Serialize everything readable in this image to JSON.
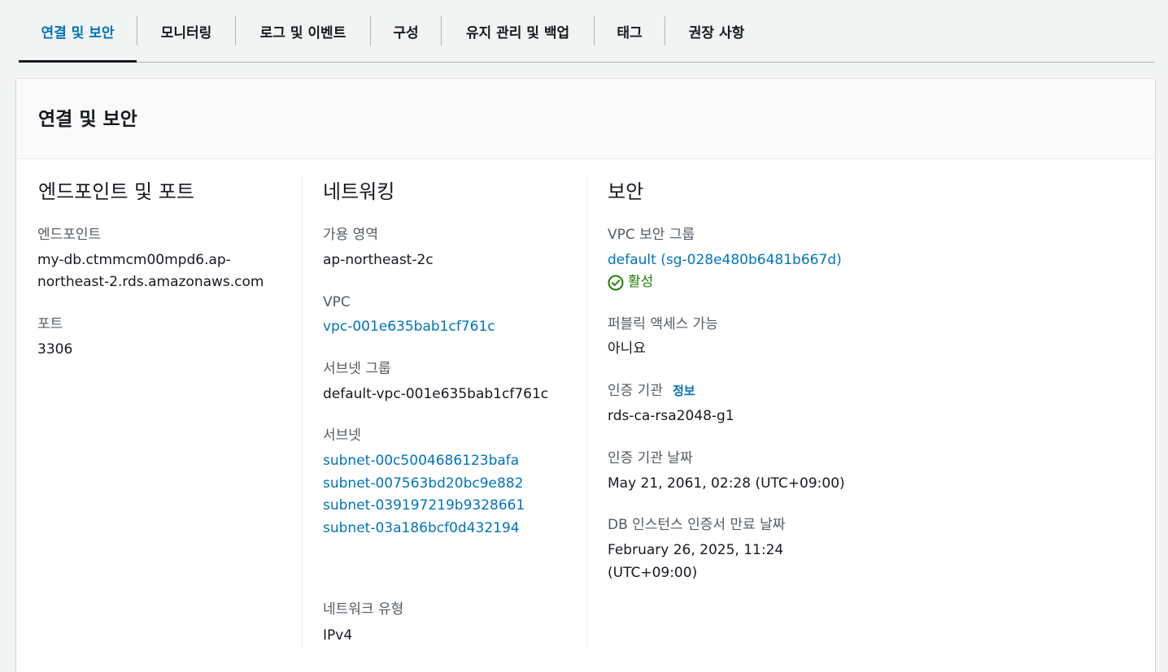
{
  "tabs": [
    {
      "label": "연결 및 보안",
      "active": true
    },
    {
      "label": "모니터링"
    },
    {
      "label": "로그 및 이벤트"
    },
    {
      "label": "구성"
    },
    {
      "label": "유지 관리 및 백업"
    },
    {
      "label": "태그"
    },
    {
      "label": "권장 사항"
    }
  ],
  "panel": {
    "title": "연결 및 보안",
    "endpoint_section": {
      "heading": "엔드포인트 및 포트",
      "endpoint_label": "엔드포인트",
      "endpoint_line1": "my-db.ctmmcm00mpd6.ap-",
      "endpoint_line2": "northeast-2.rds.amazonaws.com",
      "port_label": "포트",
      "port_value": "3306"
    },
    "network_section": {
      "heading": "네트워킹",
      "az_label": "가용 영역",
      "az_value": "ap-northeast-2c",
      "vpc_label": "VPC",
      "vpc_value": "vpc-001e635bab1cf761c",
      "subnet_group_label": "서브넷 그룹",
      "subnet_group_value": "default-vpc-001e635bab1cf761c",
      "subnets_label": "서브넷",
      "subnets": [
        "subnet-00c5004686123bafa",
        "subnet-007563bd20bc9e882",
        "subnet-039197219b9328661",
        "subnet-03a186bcf0d432194"
      ],
      "network_type_label": "네트워크 유형",
      "network_type_value": "IPv4"
    },
    "security_section": {
      "heading": "보안",
      "sg_label": "VPC 보안 그룹",
      "sg_value": "default (sg-028e480b6481b667d)",
      "sg_status": "활성",
      "public_label": "퍼블릭 액세스 가능",
      "public_value": "아니요",
      "ca_label": "인증 기관",
      "ca_info": "정보",
      "ca_value": "rds-ca-rsa2048-g1",
      "ca_date_label": "인증 기관 날짜",
      "ca_date_value": "May 21, 2061, 02:28 (UTC+09:00)",
      "cert_expiry_label": "DB 인스턴스 인증서 만료 날짜",
      "cert_expiry_line1": "February 26, 2025, 11:24",
      "cert_expiry_line2": "(UTC+09:00)"
    }
  },
  "colors": {
    "accent": "#0073bb",
    "success": "#1d8102",
    "label": "#545b64"
  }
}
